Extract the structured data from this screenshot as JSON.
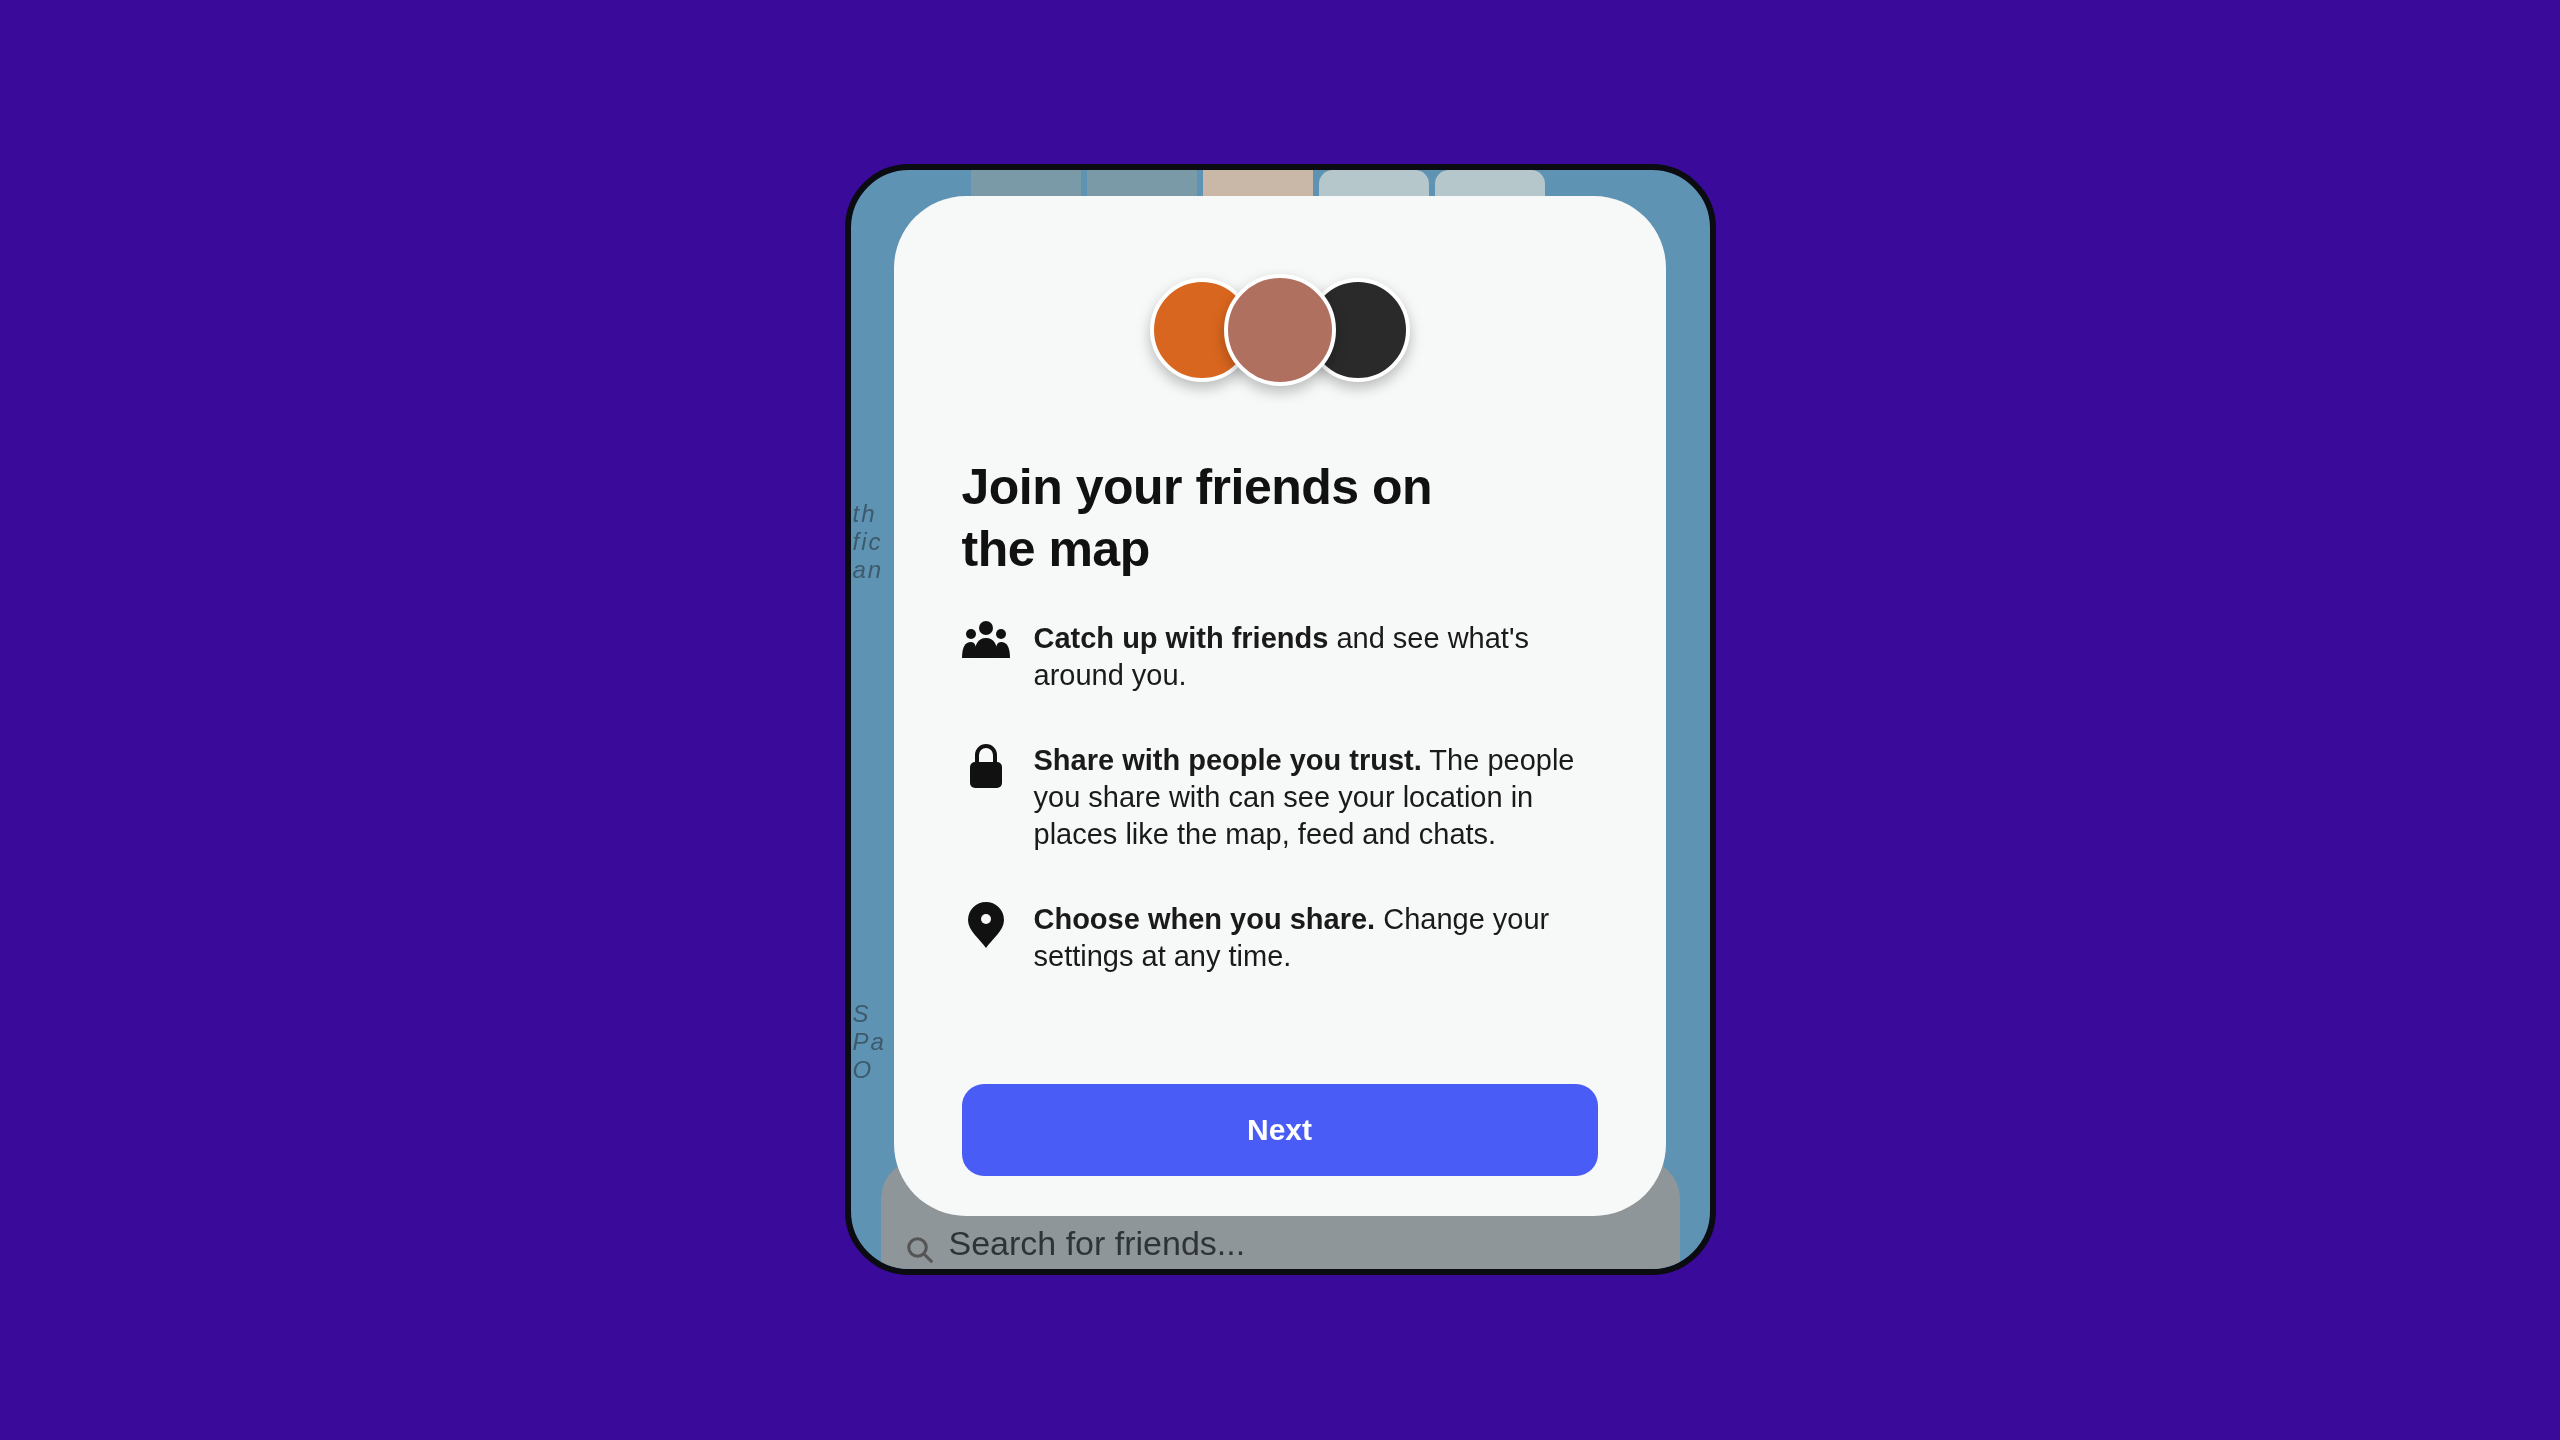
{
  "map": {
    "labels_upper": [
      "th",
      "fic",
      "an"
    ],
    "labels_lower": [
      "S",
      "Pa",
      "O"
    ]
  },
  "search": {
    "placeholder": "Search for friends..."
  },
  "dialog": {
    "title": "Join your friends on the map",
    "features": [
      {
        "kind": "friends",
        "text": "**Catch up with friends** and see what's around you."
      },
      {
        "kind": "lock",
        "text": "**Share with people you trust.** The people you share with can see your location in places like the map, feed and chats."
      },
      {
        "kind": "pin",
        "text": "**Choose when you share.** Change your settings at any time."
      }
    ],
    "button": "Next"
  }
}
